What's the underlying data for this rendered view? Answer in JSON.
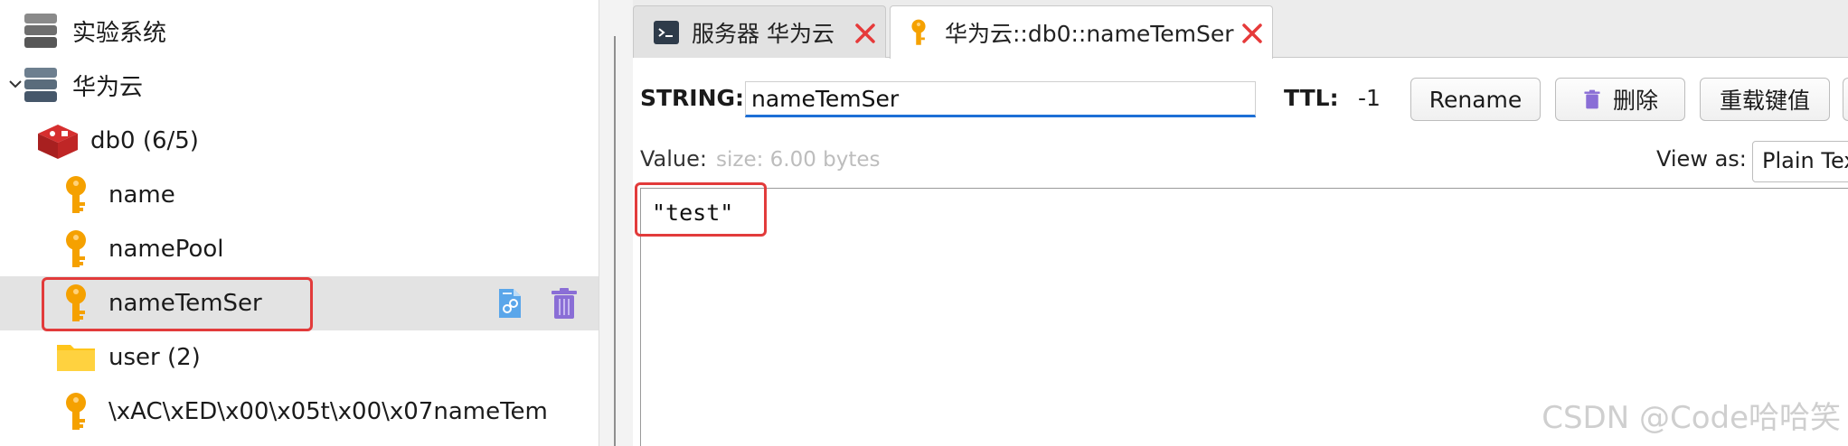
{
  "tree": {
    "items": [
      {
        "label": "实验系统",
        "type": "server"
      },
      {
        "label": "华为云",
        "type": "server"
      },
      {
        "label": "db0  (6/5)",
        "type": "database"
      },
      {
        "label": "name",
        "type": "key"
      },
      {
        "label": "namePool",
        "type": "key"
      },
      {
        "label": "nameTemSer",
        "type": "key",
        "selected": true
      },
      {
        "label": "user (2)",
        "type": "folder"
      },
      {
        "label": "\\xAC\\xED\\x00\\x05t\\x00\\x07nameTem",
        "type": "key"
      }
    ],
    "selected_icons": [
      "copy-link-icon",
      "trash-icon"
    ]
  },
  "tabs": [
    {
      "label": "服务器 华为云",
      "icon": "terminal-icon"
    },
    {
      "label": "华为云::db0::nameTemSer",
      "icon": "key-icon",
      "active": true
    }
  ],
  "key_view": {
    "type_label": "STRING:",
    "key_name": "nameTemSer",
    "ttl_label": "TTL:",
    "ttl_value": "-1",
    "rename_label": "Rename",
    "delete_label": "删除",
    "reload_label": "重载键值",
    "value_label": "Value:",
    "size_text": "size: 6.00 bytes",
    "view_as_label": "View as:",
    "view_as_value": "Plain Text",
    "value_content": "\"test\""
  },
  "watermark": "CSDN @Code哈哈笑",
  "colors": {
    "key_icon": "#f5a100",
    "folder_icon": "#ffc51a",
    "highlight": "#e23b3b",
    "input_focus": "#1d6fd6",
    "close_red": "#e63a3a",
    "trash_purple": "#8a6ed6"
  }
}
